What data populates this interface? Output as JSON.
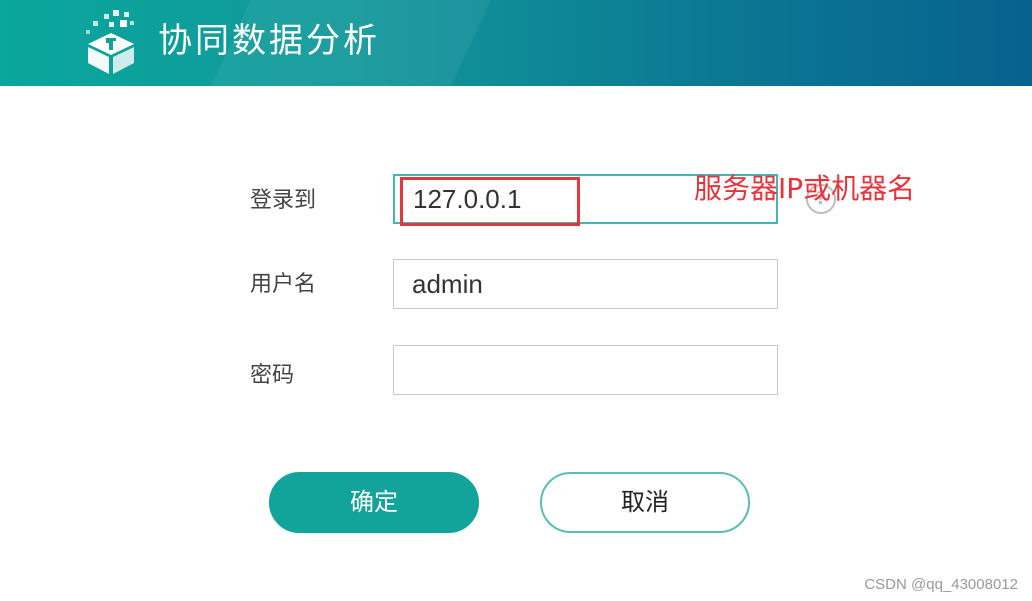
{
  "header": {
    "logo_icon": "data-cube-logo-icon",
    "title": "协同数据分析",
    "colors": {
      "gradient_start": "#0aa79c",
      "gradient_end": "#07628e"
    }
  },
  "form": {
    "server": {
      "label": "登录到",
      "value": "127.0.0.1"
    },
    "username": {
      "label": "用户名",
      "value": "admin"
    },
    "password": {
      "label": "密码",
      "value": ""
    },
    "help_icon": "question-circle-icon"
  },
  "annotation": {
    "text": "服务器IP或机器名",
    "color": "#e8333b"
  },
  "buttons": {
    "confirm": "确定",
    "cancel": "取消",
    "accent_color": "#12a39b"
  },
  "watermark": "CSDN @qq_43008012"
}
